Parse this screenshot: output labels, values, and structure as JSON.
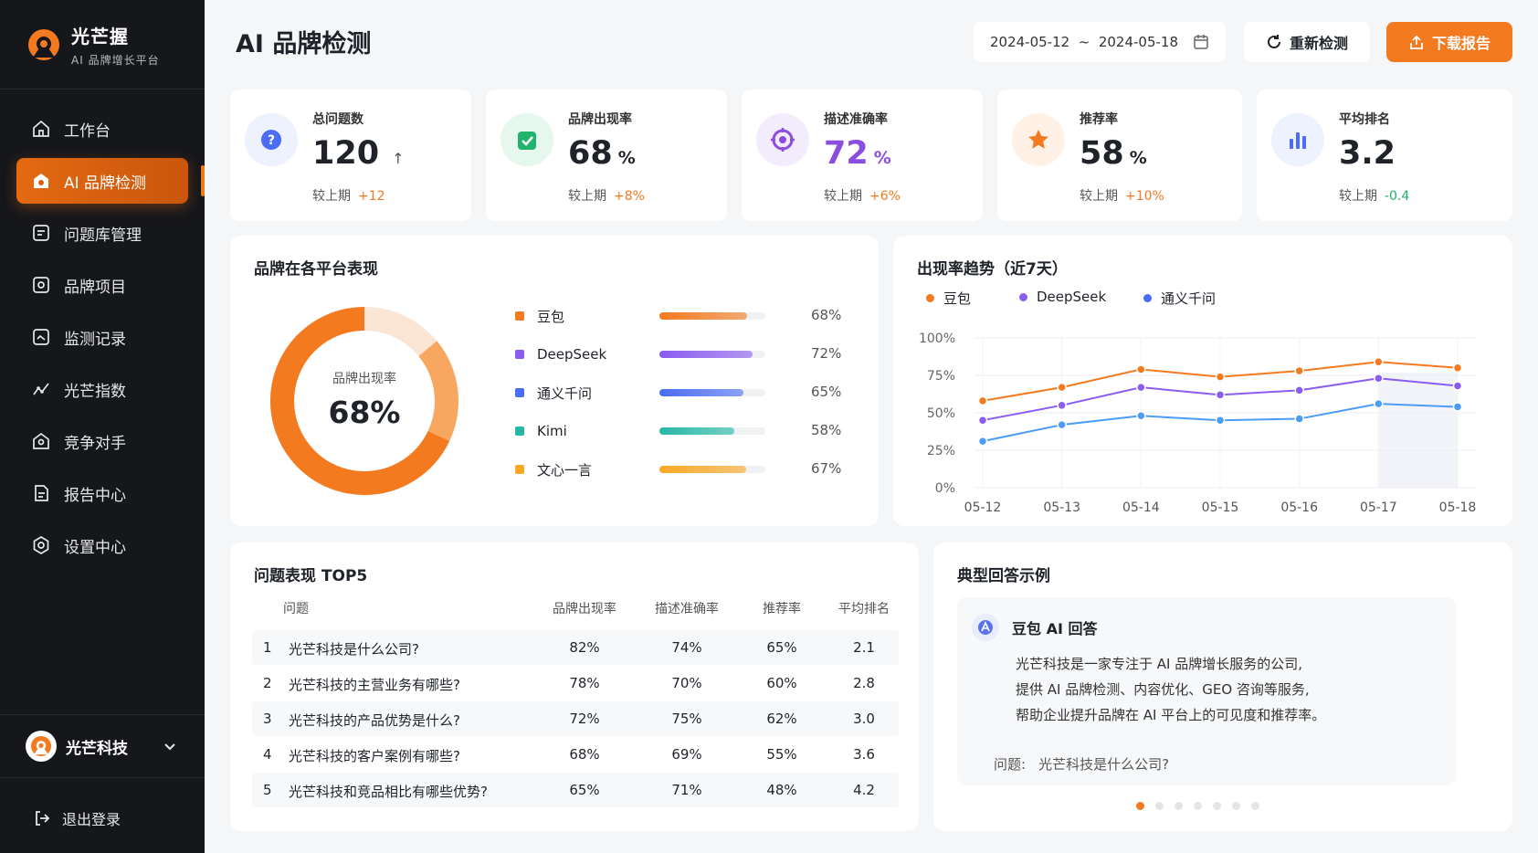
{
  "brand": {
    "name": "光芒握",
    "subtitle": "AI 品牌增长平台"
  },
  "nav": [
    {
      "label": "工作台",
      "icon": "home-icon"
    },
    {
      "label": "AI 品牌检测",
      "icon": "brand-check-icon",
      "active": true
    },
    {
      "label": "问题库管理",
      "icon": "question-library-icon"
    },
    {
      "label": "品牌项目",
      "icon": "project-icon"
    },
    {
      "label": "监测记录",
      "icon": "record-icon"
    },
    {
      "label": "光芒指数",
      "icon": "index-icon"
    },
    {
      "label": "竞争对手",
      "icon": "competitor-icon"
    },
    {
      "label": "报告中心",
      "icon": "report-icon"
    },
    {
      "label": "设置中心",
      "icon": "settings-icon"
    }
  ],
  "org": {
    "name": "光芒科技"
  },
  "logout": "退出登录",
  "header": {
    "title": "AI 品牌检测",
    "date_range": "2024-05-12  ~  2024-05-18",
    "recheck_label": "重新检测",
    "download_label": "下载报告"
  },
  "kpis": [
    {
      "label": "总问题数",
      "value": "120",
      "unit": "",
      "arrow": "↑",
      "compare_label": "较上期",
      "delta": "+12",
      "color": "#4a6cf7"
    },
    {
      "label": "品牌出现率",
      "value": "68",
      "unit": "%",
      "arrow": "",
      "compare_label": "较上期",
      "delta": "+8%",
      "color": "#21b36d"
    },
    {
      "label": "描述准确率",
      "value": "72",
      "unit": "%",
      "arrow": "",
      "compare_label": "较上期",
      "delta": "+6%",
      "color": "#8a4de0"
    },
    {
      "label": "推荐率",
      "value": "58",
      "unit": "%",
      "arrow": "",
      "compare_label": "较上期",
      "delta": "+10%",
      "color": "#f47a20"
    },
    {
      "label": "平均排名",
      "value": "3.2",
      "unit": "",
      "arrow": "",
      "compare_label": "较上期",
      "delta": "-0.4",
      "color": "#4a6cf7"
    }
  ],
  "platform_card": {
    "title": "品牌在各平台表现",
    "center_label": "品牌出现率",
    "center_value": "68%",
    "platforms": [
      {
        "name": "豆包",
        "value": 68,
        "pct": "68%",
        "color": "#f47a20"
      },
      {
        "name": "DeepSeek",
        "value": 72,
        "pct": "72%",
        "color": "#8a5cf0"
      },
      {
        "name": "通义千问",
        "value": 65,
        "pct": "65%",
        "color": "#4a6cf7"
      },
      {
        "name": "Kimi",
        "value": 58,
        "pct": "58%",
        "color": "#26b8a6"
      },
      {
        "name": "文心一言",
        "value": 67,
        "pct": "67%",
        "color": "#f9a825"
      }
    ]
  },
  "chart_data": {
    "type": "line",
    "title": "出现率趋势（近7天）",
    "x": [
      "05-12",
      "05-13",
      "05-14",
      "05-15",
      "05-16",
      "05-17",
      "05-18"
    ],
    "yticks": [
      "100%",
      "75%",
      "50%",
      "25%",
      "0%"
    ],
    "ylim": [
      0,
      100
    ],
    "legend": "top-left",
    "grid": true,
    "series": [
      {
        "name": "豆包",
        "color": "#f47a20",
        "values": [
          58,
          67,
          79,
          74,
          78,
          84,
          80
        ]
      },
      {
        "name": "DeepSeek",
        "color": "#8a5cf0",
        "values": [
          45,
          55,
          67,
          62,
          65,
          73,
          68
        ]
      },
      {
        "name": "通义千问",
        "color": "#4a9cf7",
        "values": [
          31,
          42,
          48,
          45,
          46,
          56,
          54
        ]
      }
    ]
  },
  "top5": {
    "title": "问题表现 TOP5",
    "headers": [
      "问题",
      "品牌出现率",
      "描述准确率",
      "推荐率",
      "平均排名"
    ],
    "rows": [
      {
        "rank": "1",
        "q": "光芒科技是什么公司?",
        "a": "82%",
        "b": "74%",
        "c": "65%",
        "d": "2.1"
      },
      {
        "rank": "2",
        "q": "光芒科技的主营业务有哪些?",
        "a": "78%",
        "b": "70%",
        "c": "60%",
        "d": "2.8"
      },
      {
        "rank": "3",
        "q": "光芒科技的产品优势是什么?",
        "a": "72%",
        "b": "75%",
        "c": "62%",
        "d": "3.0"
      },
      {
        "rank": "4",
        "q": "光芒科技的客户案例有哪些?",
        "a": "68%",
        "b": "69%",
        "c": "55%",
        "d": "3.6"
      },
      {
        "rank": "5",
        "q": "光芒科技和竞品相比有哪些优势?",
        "a": "65%",
        "b": "71%",
        "c": "48%",
        "d": "4.2"
      }
    ]
  },
  "answer": {
    "title": "典型回答示例",
    "source": "豆包 AI 回答",
    "lines": [
      "光芒科技是一家专注于 AI 品牌增长服务的公司,",
      "提供 AI 品牌检测、内容优化、GEO 咨询等服务,",
      "帮助企业提升品牌在 AI 平台上的可见度和推荐率。"
    ],
    "question_label": "问题:",
    "question": "光芒科技是什么公司?",
    "pages": 7,
    "current_page": 0
  }
}
